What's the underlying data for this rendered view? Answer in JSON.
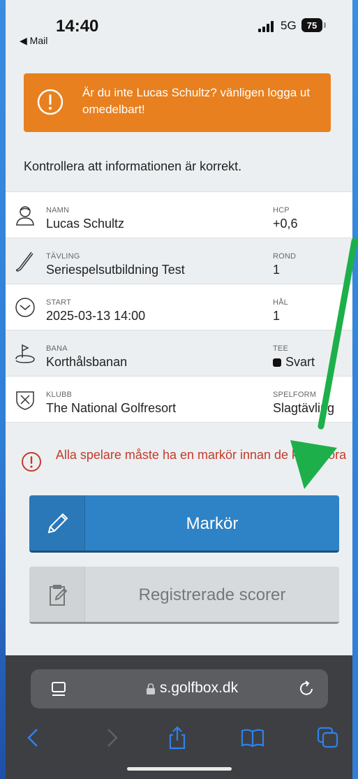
{
  "status": {
    "back_app": "◀ Mail",
    "time": "14:40",
    "network": "5G",
    "battery": "75"
  },
  "warning": {
    "text": "Är du inte Lucas Schultz? vänligen logga ut omedelbart!",
    "icon": "exclamation-circle-icon"
  },
  "instruction": "Kontrollera att informationen är korrekt.",
  "info_rows": [
    {
      "icon": "person-icon",
      "left_label": "NAMN",
      "left_value": "Lucas Schultz",
      "right_label": "HCP",
      "right_value": "+0,6"
    },
    {
      "icon": "golf-club-icon",
      "left_label": "TÄVLING",
      "left_value": "Seriespelsutbildning Test",
      "right_label": "ROND",
      "right_value": "1"
    },
    {
      "icon": "clock-icon",
      "left_label": "START",
      "left_value": "2025-03-13 14:00",
      "right_label": "HÅL",
      "right_value": "1"
    },
    {
      "icon": "golf-flag-icon",
      "left_label": "BANA",
      "left_value": "Korthålsbanan",
      "right_label": "TEE",
      "right_value": "Svart"
    },
    {
      "icon": "club-crest-icon",
      "left_label": "KLUBB",
      "left_value": "The National Golfresort",
      "right_label": "SPELFORM",
      "right_value": "Slagtävling"
    }
  ],
  "error_message": "Alla spelare måste ha en markör innan de kan scora",
  "buttons": {
    "marker": "Markör",
    "registered_scores": "Registrerade scorer"
  },
  "browser": {
    "url": "s.golfbox.dk"
  },
  "colors": {
    "warning": "#e8801f",
    "primary_button": "#2e82c6",
    "error_text": "#c33b2a",
    "annotation_arrow": "#1db04a"
  }
}
